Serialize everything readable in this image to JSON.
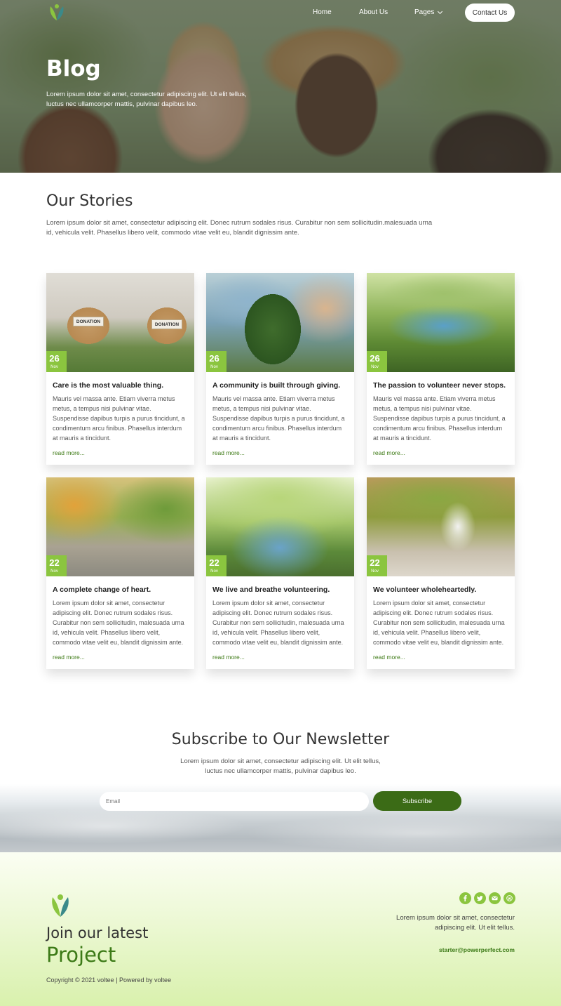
{
  "brand": {
    "primary": "#8bc53f",
    "dark_green": "#3b6b16"
  },
  "nav": {
    "home": "Home",
    "about": "About Us",
    "pages": "Pages",
    "contact": "Contact Us"
  },
  "hero": {
    "title": "Blog",
    "text": "Lorem ipsum dolor sit amet, consectetur adipiscing elit. Ut elit tellus, luctus nec ullamcorper mattis, pulvinar dapibus leo."
  },
  "stories": {
    "title": "Our Stories",
    "text": "Lorem ipsum dolor sit amet, consectetur adipiscing elit. Donec rutrum sodales risus. Curabitur non sem sollicitudin.malesuada urna id, vehicula velit. Phasellus libero velit, commodo vitae velit eu, blandit dignissim ante."
  },
  "cards": [
    {
      "day": "26",
      "month": "Nov",
      "title": "Care is the most valuable thing.",
      "text": "Mauris vel massa ante. Etiam viverra metus metus, a tempus nisi pulvinar vitae. Suspendisse dapibus turpis a purus tincidunt, a condimentum arcu finibus. Phasellus interdum at mauris a tincidunt.",
      "link": "read more...",
      "label1": "DONATION",
      "label2": "DONATION"
    },
    {
      "day": "26",
      "month": "Nov",
      "title": "A community is built through giving.",
      "text": "Mauris vel massa ante. Etiam viverra metus metus, a tempus nisi pulvinar vitae. Suspendisse dapibus turpis a purus tincidunt, a condimentum arcu finibus. Phasellus interdum at mauris a tincidunt.",
      "link": "read more..."
    },
    {
      "day": "26",
      "month": "Nov",
      "title": "The passion to volunteer never stops.",
      "text": "Mauris vel massa ante. Etiam viverra metus metus, a tempus nisi pulvinar vitae. Suspendisse dapibus turpis a purus tincidunt, a condimentum arcu finibus. Phasellus interdum at mauris a tincidunt.",
      "link": "read more..."
    },
    {
      "day": "22",
      "month": "Nov",
      "title": "A complete change of heart.",
      "text": "Lorem ipsum dolor sit amet, consectetur adipiscing elit. Donec rutrum sodales risus. Curabitur non sem sollicitudin, malesuada urna id, vehicula velit. Phasellus libero velit, commodo vitae velit eu, blandit dignissim ante.",
      "link": "read more..."
    },
    {
      "day": "22",
      "month": "Nov",
      "title": "We live and breathe volunteering.",
      "text": "Lorem ipsum dolor sit amet, consectetur adipiscing elit. Donec rutrum sodales risus. Curabitur non sem sollicitudin, malesuada urna id, vehicula velit. Phasellus libero velit, commodo vitae velit eu, blandit dignissim ante.",
      "link": "read more..."
    },
    {
      "day": "22",
      "month": "Nov",
      "title": "We volunteer wholeheartedly.",
      "text": "Lorem ipsum dolor sit amet, consectetur adipiscing elit. Donec rutrum sodales risus. Curabitur non sem sollicitudin, malesuada urna id, vehicula velit. Phasellus libero velit, commodo vitae velit eu, blandit dignissim ante.",
      "link": "read more..."
    }
  ],
  "newsletter": {
    "title": "Subscribe to Our Newsletter",
    "text": "Lorem ipsum dolor sit amet, consectetur adipiscing elit. Ut elit tellus, luctus nec ullamcorper mattis, pulvinar dapibus leo.",
    "email_placeholder": "Email",
    "button": "Subscribe"
  },
  "footer": {
    "heading": "Join our latest",
    "project": "Project",
    "copyright": "Copyright © 2021 voltee | Powered by voltee",
    "text": "Lorem ipsum dolor sit amet, consectetur adipiscing elit. Ut elit tellus.",
    "email": "starter@powerperfect.com",
    "social_icons": [
      "facebook-icon",
      "twitter-icon",
      "email-icon",
      "wordpress-icon"
    ]
  }
}
